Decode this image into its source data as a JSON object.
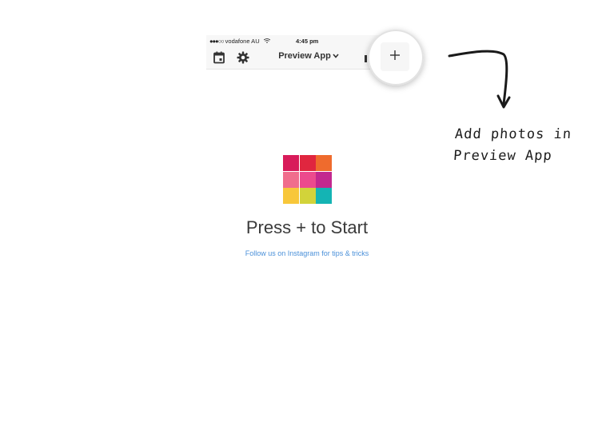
{
  "status_bar": {
    "carrier": "vodafone AU",
    "signal": "●●●○○",
    "time": "4:45 pm",
    "battery_percent": "%"
  },
  "nav": {
    "title": "Preview App",
    "chevron": "⌄",
    "plus": "+"
  },
  "callout": {
    "line1": "Add photos in",
    "line2": "Preview App"
  },
  "main": {
    "title": "Press + to Start",
    "link": "Follow us on Instagram for tips & tricks"
  },
  "logo_colors": [
    "#d81b5a",
    "#e0263f",
    "#ef6b2d",
    "#f06d8c",
    "#ec4a8d",
    "#c3288f",
    "#f8c73a",
    "#d2d33a",
    "#14b4b4"
  ],
  "icons": {
    "calendar": "calendar-icon",
    "settings": "gear-icon",
    "add": "plus-icon",
    "wifi": "wifi-icon",
    "battery": "battery-icon"
  },
  "colors": {
    "link": "#4a90d9",
    "battery": "#4cd964"
  }
}
